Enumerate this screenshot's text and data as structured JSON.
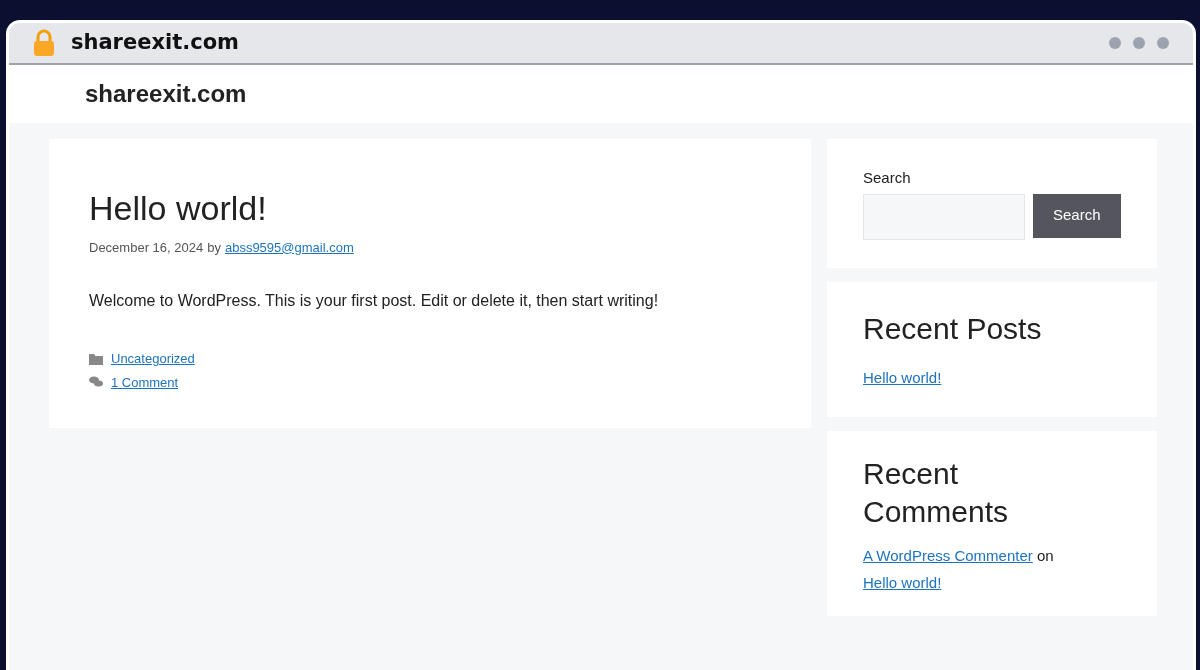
{
  "browser": {
    "address": "shareexit.com"
  },
  "site": {
    "title": "shareexit.com"
  },
  "post": {
    "title": "Hello world!",
    "date": "December 16, 2024",
    "by": "by",
    "author": "abss9595@gmail.com",
    "body": "Welcome to WordPress. This is your first post. Edit or delete it, then start writing!",
    "category": "Uncategorized",
    "comments": "1 Comment"
  },
  "search": {
    "label": "Search",
    "button": "Search"
  },
  "recent_posts": {
    "title": "Recent Posts",
    "items": [
      "Hello world!"
    ]
  },
  "recent_comments": {
    "title": "Recent Comments",
    "items": [
      {
        "author": "A WordPress Commenter",
        "on": "on",
        "post": "Hello world!"
      }
    ]
  }
}
